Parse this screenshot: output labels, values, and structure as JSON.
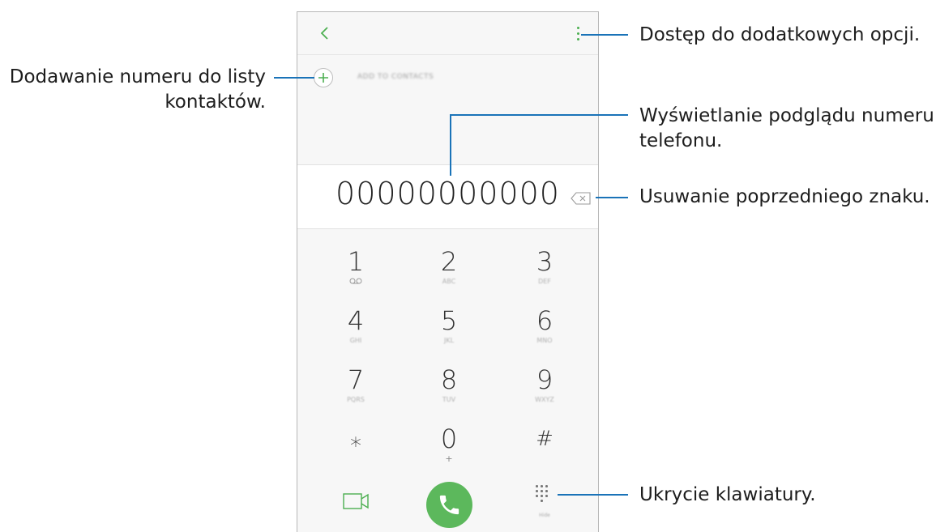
{
  "dialer": {
    "add_to_contacts_label": "ADD TO CONTACTS",
    "phone_number": "00000000000",
    "keys": [
      {
        "digit": "1",
        "letters": ""
      },
      {
        "digit": "2",
        "letters": "ABC"
      },
      {
        "digit": "3",
        "letters": "DEF"
      },
      {
        "digit": "4",
        "letters": "GHI"
      },
      {
        "digit": "5",
        "letters": "JKL"
      },
      {
        "digit": "6",
        "letters": "MNO"
      },
      {
        "digit": "7",
        "letters": "PQRS"
      },
      {
        "digit": "8",
        "letters": "TUV"
      },
      {
        "digit": "9",
        "letters": "WXYZ"
      },
      {
        "digit": "⁎",
        "letters": ""
      },
      {
        "digit": "0",
        "letters": "+"
      },
      {
        "digit": "#",
        "letters": ""
      }
    ],
    "hide_label": "Hide",
    "icons": {
      "back": "back-arrow-icon",
      "more": "more-options-icon",
      "add": "plus-icon",
      "backspace": "backspace-icon",
      "voicemail": "voicemail-icon",
      "video_call": "video-call-icon",
      "call": "phone-icon",
      "dialpad": "dialpad-icon"
    },
    "colors": {
      "accent": "#4caf50",
      "call_button": "#5cb85c",
      "callout_line": "#1a73b8"
    }
  },
  "annotations": {
    "more_options": "Dostęp do dodatkowych opcji.",
    "add_number": "Dodawanie numeru do listy kontaktów.",
    "add_number_line1": "Dodawanie numeru do listy",
    "add_number_line2": "kontaktów.",
    "preview_line1": "Wyświetlanie podglądu numeru",
    "preview_line2": "telefonu.",
    "delete": "Usuwanie poprzedniego znaku.",
    "hide_keypad": "Ukrycie klawiatury."
  }
}
